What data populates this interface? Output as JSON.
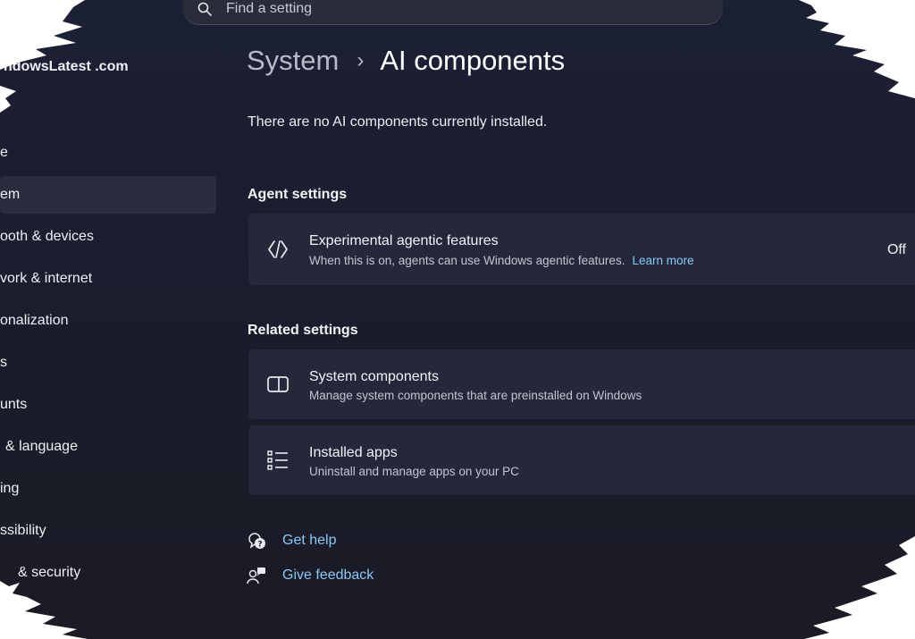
{
  "search": {
    "placeholder": "Find a setting",
    "icon": "search-icon"
  },
  "sidebar": {
    "brand": "ndowsLatest .com",
    "items": [
      {
        "label": "e"
      },
      {
        "label": "em",
        "active": true
      },
      {
        "label": "ooth & devices"
      },
      {
        "label": "vork & internet"
      },
      {
        "label": "onalization"
      },
      {
        "label": "s"
      },
      {
        "label": "unts"
      },
      {
        "label": "& language"
      },
      {
        "label": "ing"
      },
      {
        "label": "ssibility"
      },
      {
        "label": "& security"
      }
    ]
  },
  "header": {
    "parent": "System",
    "separator": "›",
    "current": "AI components"
  },
  "main": {
    "empty_message": "There are no AI components currently installed.",
    "agent_section": {
      "title": "Agent settings",
      "card": {
        "title": "Experimental agentic features",
        "description": "When this is on, agents can use Windows agentic features.",
        "link": "Learn more",
        "value": "Off",
        "icon": "agent-icon"
      }
    },
    "related_section": {
      "title": "Related settings",
      "cards": [
        {
          "title": "System components",
          "description": "Manage system components that are preinstalled on Windows",
          "icon": "system-components-icon"
        },
        {
          "title": "Installed apps",
          "description": "Uninstall and manage apps on your PC",
          "icon": "apps-list-icon"
        }
      ]
    },
    "help": {
      "get_help": "Get help",
      "give_feedback": "Give feedback"
    }
  },
  "colors": {
    "background": "#1b1d2b",
    "card": "#25283a",
    "link": "#8ac8f5",
    "active_nav": "#2a2d3d"
  }
}
